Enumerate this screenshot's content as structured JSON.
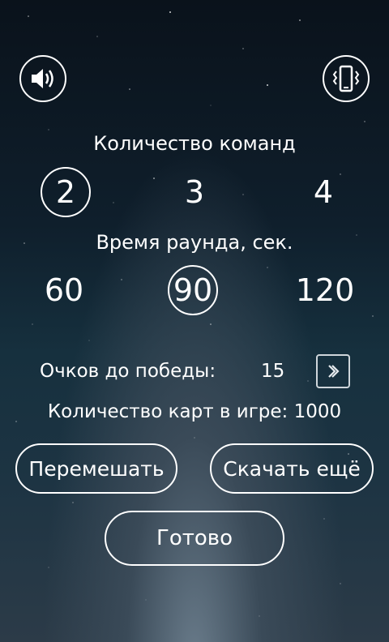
{
  "sound_button": {
    "icon": "speaker-icon"
  },
  "vibration_button": {
    "icon": "vibrate-phone-icon"
  },
  "teams": {
    "label": "Количество команд",
    "options": [
      "2",
      "3",
      "4"
    ],
    "selected": "2"
  },
  "round_time": {
    "label": "Время раунда, сек.",
    "options": [
      "60",
      "90",
      "120"
    ],
    "selected": "90"
  },
  "points_to_win": {
    "label": "Очков до победы:",
    "value": "15",
    "next_icon": "chevron-right-icon"
  },
  "cards_in_game": {
    "label": "Количество карт в игре: 1000"
  },
  "buttons": {
    "shuffle": "Перемешать",
    "download_more": "Скачать ещё",
    "done": "Готово"
  },
  "colors": {
    "text": "#ffffff",
    "background_top": "#0a121b",
    "background_bottom": "#2c3b48"
  }
}
